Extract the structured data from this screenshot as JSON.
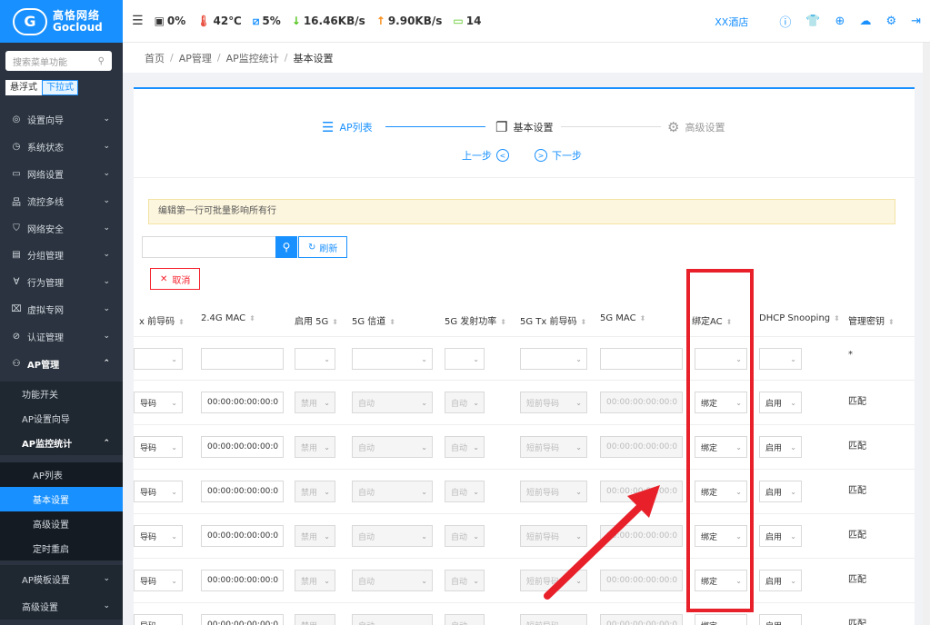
{
  "brand": {
    "logo_glyph": "G",
    "name_cn": "高恪网络",
    "name_en": "Gocloud"
  },
  "sidebar": {
    "search_placeholder": "搜索菜单功能",
    "modes": [
      "悬浮式",
      "下拉式"
    ],
    "menu": [
      {
        "label": "设置向导",
        "icon": "◎",
        "name": "sidebar-item-setup-wizard"
      },
      {
        "label": "系统状态",
        "icon": "◷",
        "name": "sidebar-item-system-status"
      },
      {
        "label": "网络设置",
        "icon": "▭",
        "name": "sidebar-item-network-settings"
      },
      {
        "label": "流控多线",
        "icon": "品",
        "name": "sidebar-item-flow-control"
      },
      {
        "label": "网络安全",
        "icon": "⛉",
        "name": "sidebar-item-network-security"
      },
      {
        "label": "分组管理",
        "icon": "▤",
        "name": "sidebar-item-group-management"
      },
      {
        "label": "行为管理",
        "icon": "∀",
        "name": "sidebar-item-behavior-management"
      },
      {
        "label": "虚拟专网",
        "icon": "⌧",
        "name": "sidebar-item-vpn"
      },
      {
        "label": "认证管理",
        "icon": "⊘",
        "name": "sidebar-item-auth-management"
      },
      {
        "label": "AP管理",
        "icon": "⚇",
        "name": "sidebar-item-ap-management"
      }
    ],
    "sub": {
      "func_switch": "功能开关",
      "ap_wizard": "AP设置向导",
      "ap_monitor": "AP监控统计",
      "ap_list": "AP列表",
      "basic": "基本设置",
      "advanced": "高级设置",
      "reboot": "定时重启",
      "ap_template": "AP模板设置",
      "adv_settings": "高级设置"
    }
  },
  "topbar": {
    "cpu": "0%",
    "temp": "42℃",
    "mem": "5%",
    "down": "16.46KB/s",
    "up": "9.90KB/s",
    "clients": "14",
    "hotel": "XX酒店"
  },
  "breadcrumb": [
    "首页",
    "AP管理",
    "AP监控统计",
    "基本设置"
  ],
  "steps": {
    "s1": "AP列表",
    "s2": "基本设置",
    "s3": "高级设置",
    "prev": "上一步",
    "next": "下一步"
  },
  "notice": "编辑第一行可批量影响所有行",
  "toolbar": {
    "refresh": "刷新",
    "cancel": "取消"
  },
  "table": {
    "headers": [
      "x 前导码",
      "2.4G MAC",
      "启用 5G",
      "5G 信道",
      "5G 发射功率",
      "5G Tx 前导码",
      "5G MAC",
      "绑定AC",
      "DHCP Snooping",
      "管理密钥"
    ],
    "first_row_key": "*",
    "row": {
      "preamble": "导码",
      "mac": "00:00:00:00:00:0",
      "enable5g": "禁用",
      "channel": "自动",
      "power": "自动",
      "tx": "短前导码",
      "mac5g": "00:00:00:00:00:0",
      "bind": "绑定",
      "dhcp": "启用",
      "key": "匹配"
    }
  }
}
